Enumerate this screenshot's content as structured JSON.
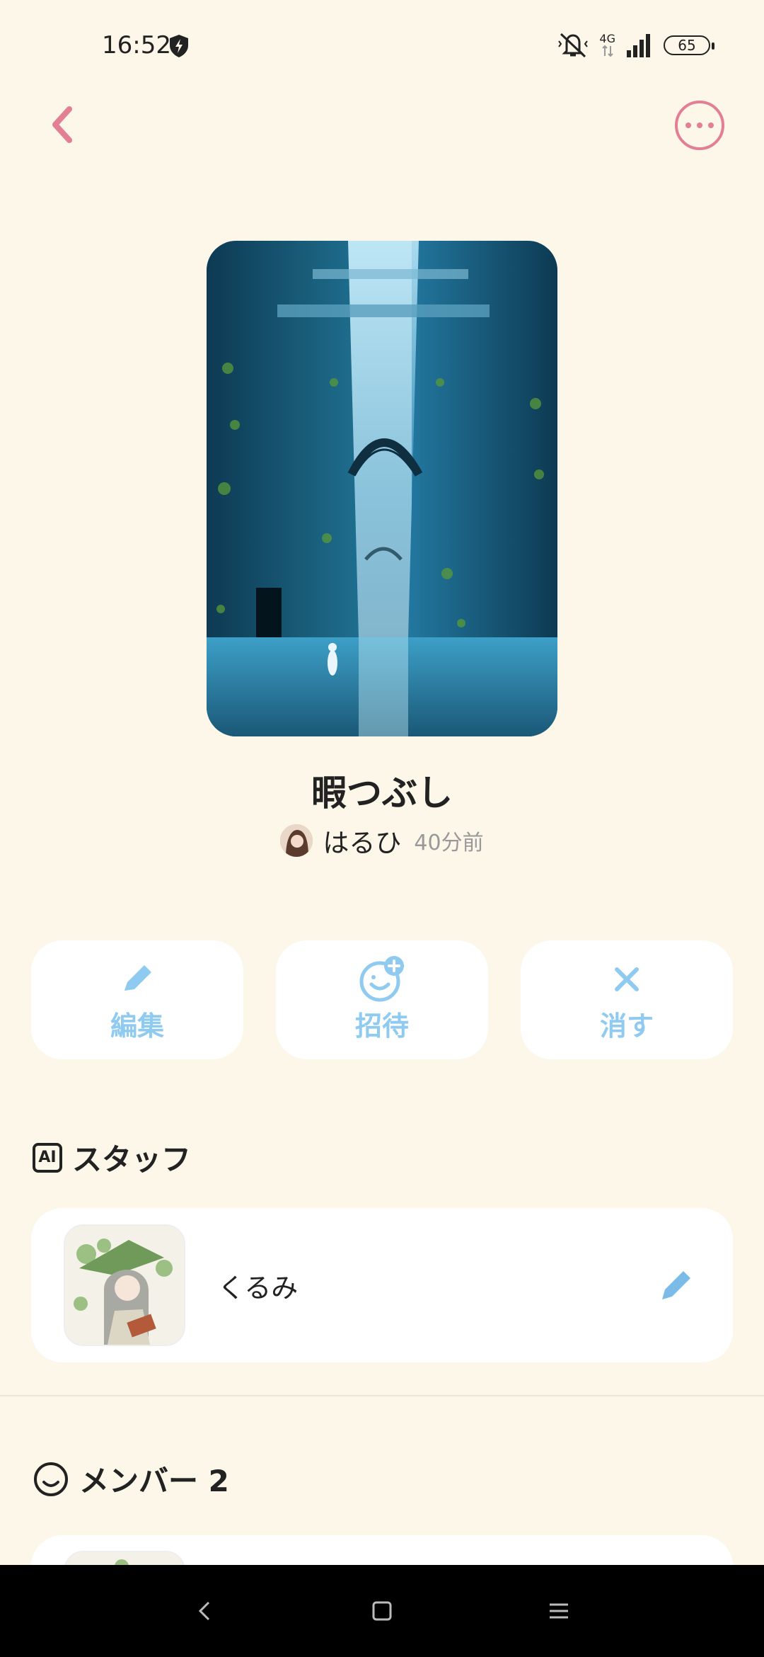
{
  "status_bar": {
    "time": "16:52",
    "network": "4G",
    "battery": "65"
  },
  "room": {
    "title": "暇つぶし",
    "owner_name": "はるひ",
    "updated": "40分前"
  },
  "actions": [
    {
      "label": "編集",
      "icon": "pencil-icon"
    },
    {
      "label": "招待",
      "icon": "invite-smile-icon"
    },
    {
      "label": "消す",
      "icon": "close-icon"
    }
  ],
  "staff_section": {
    "badge": "AI",
    "title": "スタッフ",
    "staff_name": "くるみ"
  },
  "member_section": {
    "title": "メンバー 2"
  },
  "colors": {
    "background": "#fdf7ea",
    "accent_pink": "#e37f94",
    "accent_blue": "#8fcaf0",
    "card": "#ffffff"
  }
}
